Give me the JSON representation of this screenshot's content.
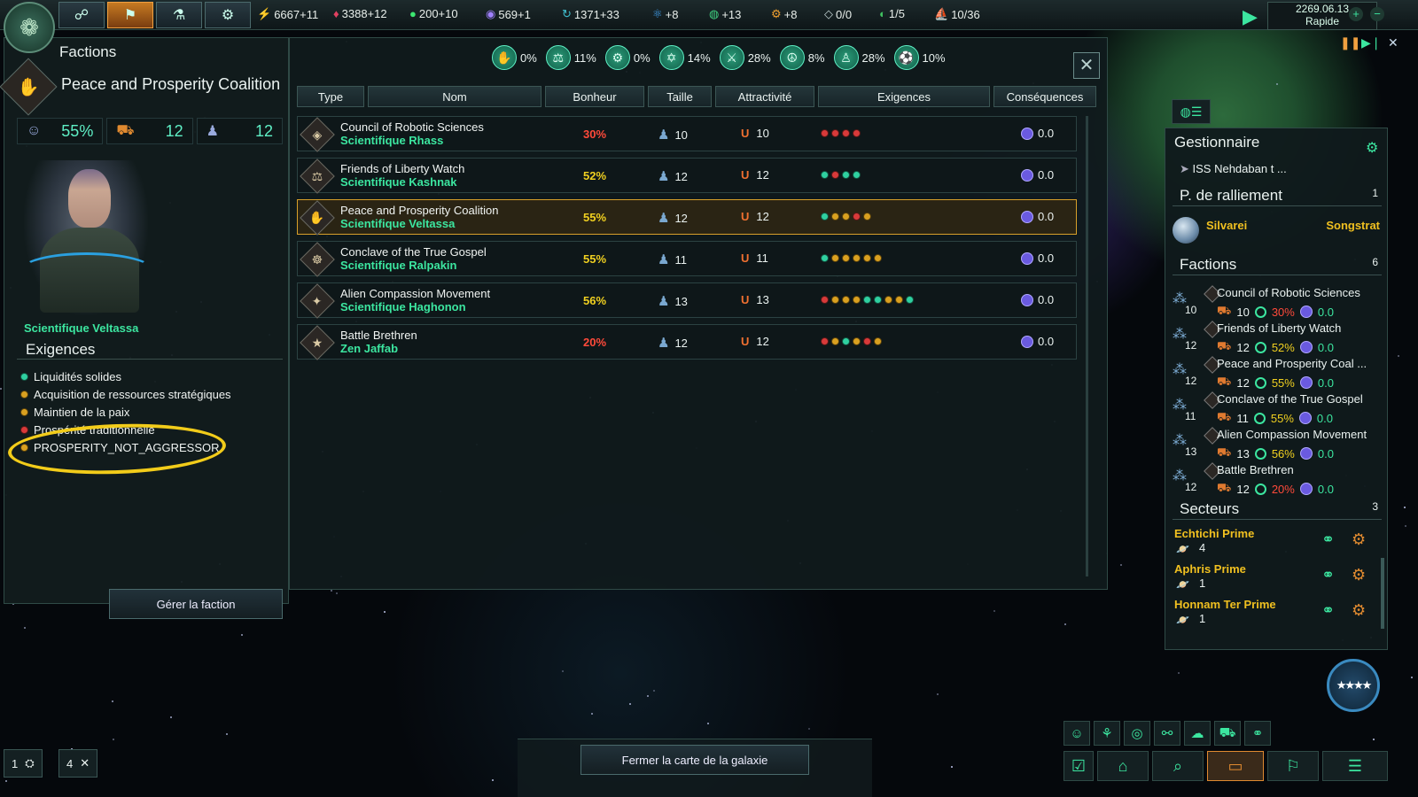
{
  "topbar": {
    "resources": [
      {
        "icon": "energy-icon",
        "value": "6667+11",
        "color": "#f0c020"
      },
      {
        "icon": "minerals-icon",
        "value": "3388+12",
        "color": "#e04060"
      },
      {
        "icon": "food-icon",
        "value": "200+10",
        "color": "#3ce670"
      },
      {
        "icon": "influence-icon",
        "value": "569+1",
        "color": "#a080ff"
      },
      {
        "icon": "unity-icon",
        "value": "1371+33",
        "color": "#40c0d0"
      },
      {
        "icon": "physics-icon",
        "value": "+8",
        "color": "#40a0f0"
      },
      {
        "icon": "society-icon",
        "value": "+13",
        "color": "#40d080"
      },
      {
        "icon": "engineering-icon",
        "value": "+8",
        "color": "#f0a030"
      },
      {
        "icon": "strategic-resource-icon",
        "value": "0/0",
        "color": "#c0d0d0"
      },
      {
        "icon": "edicts-icon",
        "value": "1/5",
        "color": "#40c060"
      },
      {
        "icon": "fleet-capacity-icon",
        "value": "10/36",
        "color": "#c0c8d0"
      }
    ],
    "date": "2269.06.13",
    "speed": "Rapide"
  },
  "left": {
    "window_title": "Factions",
    "faction_name": "Peace and Prosperity Coalition",
    "stats": {
      "happiness": "55%",
      "size": "12",
      "pops": "12"
    },
    "leader_name": "Scientifique Veltassa",
    "requirements_title": "Exigences",
    "requirements": [
      {
        "label": "Liquidités solides",
        "color": "green"
      },
      {
        "label": "Acquisition de ressources stratégiques",
        "color": "yellow"
      },
      {
        "label": "Maintien de la paix",
        "color": "yellow"
      },
      {
        "label": "Prospérité traditionnelle",
        "color": "red"
      },
      {
        "label": "PROSPERITY_NOT_AGGRESSOR",
        "color": "yellow"
      }
    ],
    "manage_button": "Gérer la faction"
  },
  "dialog": {
    "ethics": [
      {
        "icon": "xenophile-icon",
        "pct": "0%"
      },
      {
        "icon": "egalitarian-icon",
        "pct": "11%"
      },
      {
        "icon": "materialist-icon",
        "pct": "0%"
      },
      {
        "icon": "spiritualist-icon",
        "pct": "14%"
      },
      {
        "icon": "militarist-icon",
        "pct": "28%"
      },
      {
        "icon": "pacifist-icon",
        "pct": "8%"
      },
      {
        "icon": "authoritarian-icon",
        "pct": "28%"
      },
      {
        "icon": "xenophobe-icon",
        "pct": "10%"
      }
    ],
    "columns": [
      "Type",
      "Nom",
      "Bonheur",
      "Taille",
      "Attractivité",
      "Exigences",
      "Conséquences"
    ],
    "rows": [
      {
        "name": "Council of Robotic Sciences",
        "leader": "Scientifique Rhass",
        "happiness": "30%",
        "happy_color": "#ff4a3a",
        "size": "10",
        "attraction": "10",
        "consequence": "0.0",
        "icon": "◈",
        "dots": [
          "r",
          "r",
          "r",
          "r"
        ],
        "selected": false
      },
      {
        "name": "Friends of Liberty Watch",
        "leader": "Scientifique Kashnak",
        "happiness": "52%",
        "happy_color": "#f0d020",
        "size": "12",
        "attraction": "12",
        "consequence": "0.0",
        "icon": "⚖",
        "dots": [
          "g",
          "r",
          "g",
          "g"
        ],
        "selected": false
      },
      {
        "name": "Peace and Prosperity Coalition",
        "leader": "Scientifique Veltassa",
        "happiness": "55%",
        "happy_color": "#f0d020",
        "size": "12",
        "attraction": "12",
        "consequence": "0.0",
        "icon": "✋",
        "dots": [
          "g",
          "y",
          "y",
          "r",
          "y"
        ],
        "selected": true
      },
      {
        "name": "Conclave of the True Gospel",
        "leader": "Scientifique Ralpakin",
        "happiness": "55%",
        "happy_color": "#f0d020",
        "size": "11",
        "attraction": "11",
        "consequence": "0.0",
        "icon": "☸",
        "dots": [
          "g",
          "y",
          "y",
          "y",
          "y",
          "y"
        ],
        "selected": false
      },
      {
        "name": "Alien Compassion Movement",
        "leader": "Scientifique Haghonon",
        "happiness": "56%",
        "happy_color": "#f0d020",
        "size": "13",
        "attraction": "13",
        "consequence": "0.0",
        "icon": "✦",
        "dots": [
          "r",
          "y",
          "y",
          "y",
          "g",
          "g",
          "y",
          "y",
          "g"
        ],
        "selected": false
      },
      {
        "name": "Battle Brethren",
        "leader": "Zen Jaffab",
        "happiness": "20%",
        "happy_color": "#ff4a3a",
        "size": "12",
        "attraction": "12",
        "consequence": "0.0",
        "icon": "★",
        "dots": [
          "r",
          "y",
          "g",
          "y",
          "r",
          "y"
        ],
        "selected": false
      }
    ]
  },
  "outliner": {
    "title": "Gestionnaire",
    "ship": "ISS Nehdaban t ...",
    "rally": {
      "title": "P. de ralliement",
      "count": "1",
      "location": "Silvarei",
      "system": "Songstrat"
    },
    "factions": {
      "title": "Factions",
      "count": "6",
      "items": [
        {
          "name": "Council of Robotic Sciences",
          "size": "10",
          "pops": "10",
          "happiness": "30%",
          "hclass": "red",
          "influence": "0.0"
        },
        {
          "name": "Friends of Liberty Watch",
          "size": "12",
          "pops": "12",
          "happiness": "52%",
          "hclass": "yel",
          "influence": "0.0"
        },
        {
          "name": "Peace and Prosperity Coal ...",
          "size": "12",
          "pops": "12",
          "happiness": "55%",
          "hclass": "yel",
          "influence": "0.0"
        },
        {
          "name": "Conclave of the True Gospel",
          "size": "11",
          "pops": "11",
          "happiness": "55%",
          "hclass": "yel",
          "influence": "0.0"
        },
        {
          "name": "Alien Compassion Movement",
          "size": "13",
          "pops": "13",
          "happiness": "56%",
          "hclass": "yel",
          "influence": "0.0"
        },
        {
          "name": "Battle Brethren",
          "size": "12",
          "pops": "12",
          "happiness": "20%",
          "hclass": "red",
          "influence": "0.0"
        }
      ]
    },
    "sectors": {
      "title": "Secteurs",
      "count": "3",
      "items": [
        {
          "name": "Echtichi Prime",
          "count": "4"
        },
        {
          "name": "Aphris Prime",
          "count": "1"
        },
        {
          "name": "Honnam Ter Prime",
          "count": "1"
        }
      ]
    }
  },
  "bottom": {
    "close_map": "Fermer la carte de la galaxie",
    "left_counters": [
      {
        "value": "1",
        "icon": "colonize-icon"
      },
      {
        "value": "4",
        "icon": "construction-icon"
      }
    ]
  }
}
